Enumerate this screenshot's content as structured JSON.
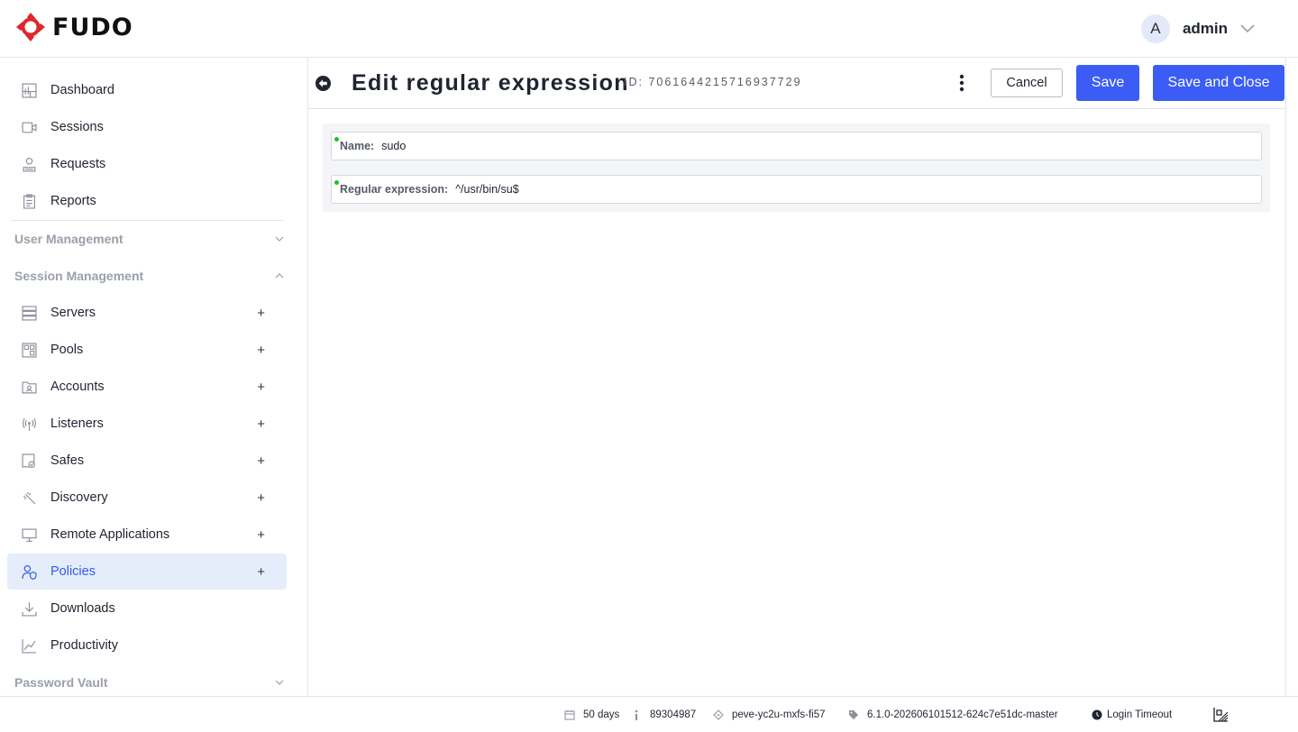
{
  "app": {
    "brand": "FUDO"
  },
  "header": {
    "user": {
      "avatar_letter": "A",
      "name": "admin"
    }
  },
  "sidebar": {
    "items_top": [
      {
        "label": "Dashboard",
        "icon": "dashboard-icon"
      },
      {
        "label": "Sessions",
        "icon": "video-camera-icon"
      },
      {
        "label": "Requests",
        "icon": "user-request-icon"
      },
      {
        "label": "Reports",
        "icon": "clipboard-icon"
      }
    ],
    "sections": {
      "user_management": {
        "label": "User Management",
        "expanded": false
      },
      "session_management": {
        "label": "Session Management",
        "expanded": true
      },
      "password_vault": {
        "label": "Password Vault",
        "expanded": false
      }
    },
    "session_items": [
      {
        "label": "Servers",
        "icon": "server-icon",
        "add": "+"
      },
      {
        "label": "Pools",
        "icon": "pool-icon",
        "add": "+"
      },
      {
        "label": "Accounts",
        "icon": "account-folder-icon",
        "add": "+"
      },
      {
        "label": "Listeners",
        "icon": "antenna-icon",
        "add": "+"
      },
      {
        "label": "Safes",
        "icon": "safe-icon",
        "add": "+"
      },
      {
        "label": "Discovery",
        "icon": "discovery-icon",
        "add": "+"
      },
      {
        "label": "Remote Applications",
        "icon": "monitor-icon",
        "add": "+"
      },
      {
        "label": "Policies",
        "icon": "policy-icon",
        "add": "+",
        "active": true
      },
      {
        "label": "Downloads",
        "icon": "download-icon"
      },
      {
        "label": "Productivity",
        "icon": "line-chart-icon"
      }
    ]
  },
  "main": {
    "title": "Edit regular expression",
    "record_id": "ID: 7061644215716937729",
    "buttons": {
      "cancel": "Cancel",
      "save": "Save",
      "save_close": "Save and Close"
    },
    "form": {
      "name": {
        "label": "Name:",
        "value": "sudo"
      },
      "regex": {
        "label": "Regular expression:",
        "value": "^/usr/bin/su$"
      }
    }
  },
  "footer": {
    "license_days": "50 days",
    "build_number": "89304987",
    "node": "peve-yc2u-mxfs-fi57",
    "version": "6.1.0-202606101512-624c7e51dc-master",
    "login_timeout": "Login Timeout"
  },
  "colors": {
    "accent": "#3b5df5",
    "active_bg": "#e5edfb",
    "logo_red": "#e0262d",
    "required_dot": "#19c623"
  }
}
